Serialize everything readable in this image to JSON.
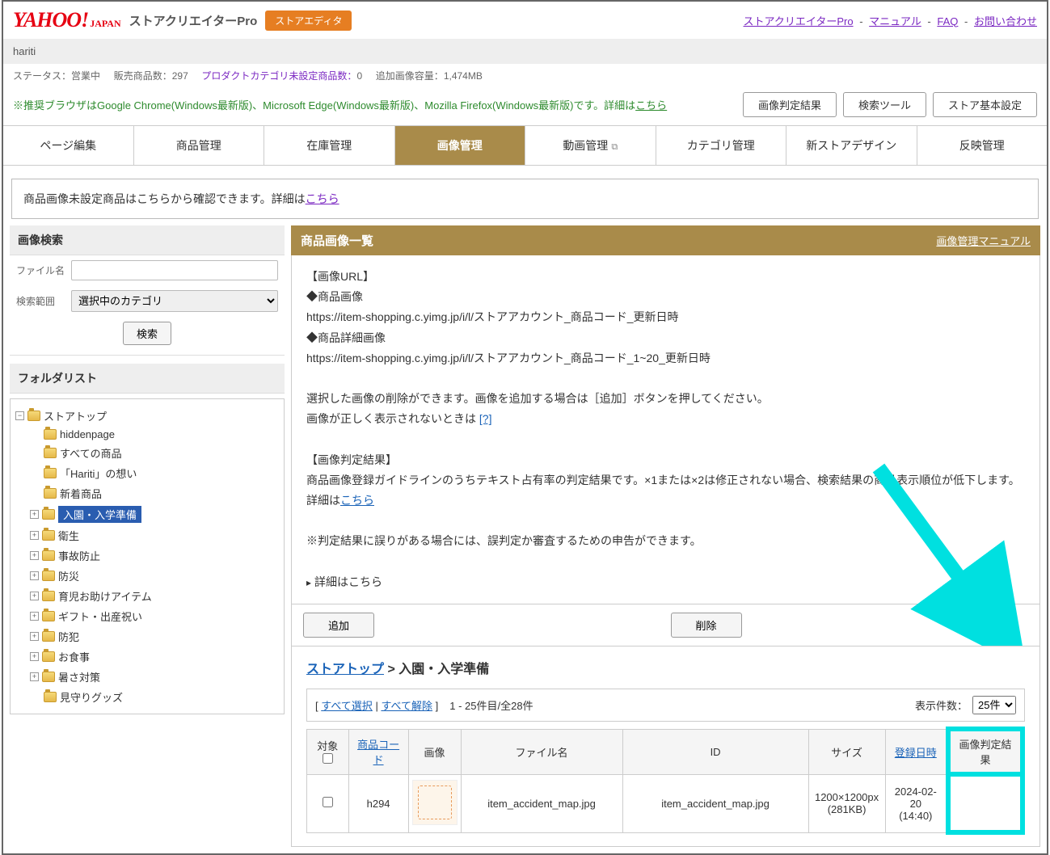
{
  "header": {
    "logo_yahoo": "YAHOO!",
    "logo_japan": "JAPAN",
    "title": "ストアクリエイターPro",
    "store_editor_btn": "ストアエディタ",
    "links": {
      "creator_pro": "ストアクリエイターPro",
      "manual": "マニュアル",
      "faq": "FAQ",
      "contact": "お問い合わせ"
    }
  },
  "subheader": {
    "store_name": "hariti"
  },
  "statusbar": {
    "status_label": "ステータス：",
    "status_value": "営業中",
    "sales_count_label": "販売商品数：",
    "sales_count_value": "297",
    "product_cat_unset_label": "プロダクトカテゴリ未設定商品数：",
    "product_cat_unset_value": "0",
    "additional_image_label": "追加画像容量：",
    "additional_image_value": "1,474MB"
  },
  "browser_note": {
    "text_prefix": "※推奨ブラウザはGoogle Chrome(Windows最新版)、Microsoft Edge(Windows最新版)、Mozilla Firefox(Windows最新版)です。詳細は",
    "link": "こちら",
    "btn_image_result": "画像判定結果",
    "btn_search_tool": "検索ツール",
    "btn_store_settings": "ストア基本設定"
  },
  "tabs": [
    "ページ編集",
    "商品管理",
    "在庫管理",
    "画像管理",
    "動画管理",
    "カテゴリ管理",
    "新ストアデザイン",
    "反映管理"
  ],
  "active_tab_index": 3,
  "external_tab_index": 4,
  "notice": {
    "text_prefix": "商品画像未設定商品はこちらから確認できます。詳細は",
    "link": "こちら"
  },
  "search": {
    "panel_title": "画像検索",
    "filename_label": "ファイル名",
    "range_label": "検索範囲",
    "range_value": "選択中のカテゴリ",
    "btn": "検索"
  },
  "folder": {
    "panel_title": "フォルダリスト",
    "root": "ストアトップ",
    "children": [
      {
        "label": "hiddenpage",
        "expandable": false
      },
      {
        "label": "すべての商品",
        "expandable": false
      },
      {
        "label": "「Hariti」の想い",
        "expandable": false
      },
      {
        "label": "新着商品",
        "expandable": false
      },
      {
        "label": "入園・入学準備",
        "expandable": true,
        "selected": true
      },
      {
        "label": "衛生",
        "expandable": true
      },
      {
        "label": "事故防止",
        "expandable": true
      },
      {
        "label": "防災",
        "expandable": true
      },
      {
        "label": "育児お助けアイテム",
        "expandable": true
      },
      {
        "label": "ギフト・出産祝い",
        "expandable": true
      },
      {
        "label": "防犯",
        "expandable": true
      },
      {
        "label": "お食事",
        "expandable": true
      },
      {
        "label": "暑さ対策",
        "expandable": true
      },
      {
        "label": "見守りグッズ",
        "expandable": false
      }
    ]
  },
  "content": {
    "header_title": "商品画像一覧",
    "header_link": "画像管理マニュアル",
    "image_url_heading": "【画像URL】",
    "product_image_label": "◆商品画像",
    "product_image_url": "https://item-shopping.c.yimg.jp/i/l/ストアアカウント_商品コード_更新日時",
    "detail_image_label": "◆商品詳細画像",
    "detail_image_url": "https://item-shopping.c.yimg.jp/i/l/ストアアカウント_商品コード_1~20_更新日時",
    "delete_note_prefix": "選択した画像の削除ができます。画像を追加する場合は［追加］ボタンを押してください。",
    "display_error_prefix": "画像が正しく表示されないときは ",
    "display_error_link": "[?]",
    "judge_heading": "【画像判定結果】",
    "judge_text": "商品画像登録ガイドラインのうちテキスト占有率の判定結果です。×1または×2は修正されない場合、検索結果の商品表示順位が低下します。",
    "judge_detail_prefix": "詳細は",
    "judge_detail_link": "こちら",
    "error_report_note": "※判定結果に誤りがある場合には、誤判定か審査するための申告ができます。",
    "details_toggle": "詳細はこちら",
    "btn_add": "追加",
    "btn_delete": "削除"
  },
  "breadcrumb": {
    "root": "ストアトップ",
    "current": "入園・入学準備",
    "sep": " > "
  },
  "list_controls": {
    "open_bracket": "[ ",
    "select_all": "すべて選択",
    "sep": " | ",
    "deselect_all": "すべて解除",
    "close_bracket": " ]",
    "count_info": "1 - 25件目/全28件",
    "display_count_label": "表示件数：",
    "display_count_value": "25件"
  },
  "table": {
    "headers": {
      "target": "対象",
      "product_code": "商品コード",
      "image": "画像",
      "filename": "ファイル名",
      "id": "ID",
      "size": "サイズ",
      "reg_date": "登録日時",
      "judge_result": "画像判定結果"
    },
    "rows": [
      {
        "product_code": "h294",
        "filename": "item_accident_map.jpg",
        "id": "item_accident_map.jpg",
        "size": "1200×1200px\n(281KB)",
        "reg_date": "2024-02-20\n(14:40)"
      }
    ]
  }
}
